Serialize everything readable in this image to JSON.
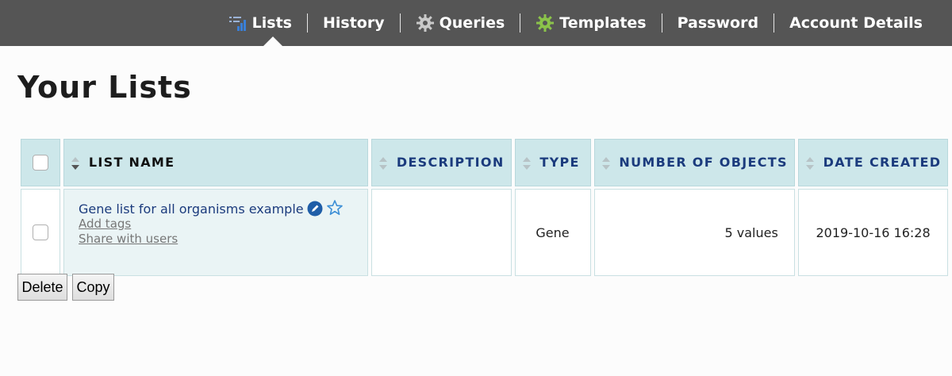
{
  "nav": {
    "items": [
      {
        "label": "Lists",
        "icon": "lists-icon"
      },
      {
        "label": "History"
      },
      {
        "label": "Queries",
        "icon": "gear-icon"
      },
      {
        "label": "Templates",
        "icon": "templates-gear-icon"
      },
      {
        "label": "Password"
      },
      {
        "label": "Account Details"
      }
    ],
    "active": "Lists"
  },
  "page_title": "Your Lists",
  "table": {
    "columns": [
      "LIST NAME",
      "DESCRIPTION",
      "TYPE",
      "NUMBER OF OBJECTS",
      "DATE CREATED"
    ],
    "rows": [
      {
        "name": "Gene list for all organisms example",
        "add_tags": "Add tags",
        "share": "Share with users",
        "description": "",
        "type": "Gene",
        "count": "5 values",
        "created": "2019-10-16 16:28"
      }
    ]
  },
  "buttons": {
    "delete": "Delete",
    "copy": "Copy"
  },
  "colors": {
    "topbar": "#555555",
    "header_bg": "#cde7ea",
    "link": "#1b3b7d"
  }
}
